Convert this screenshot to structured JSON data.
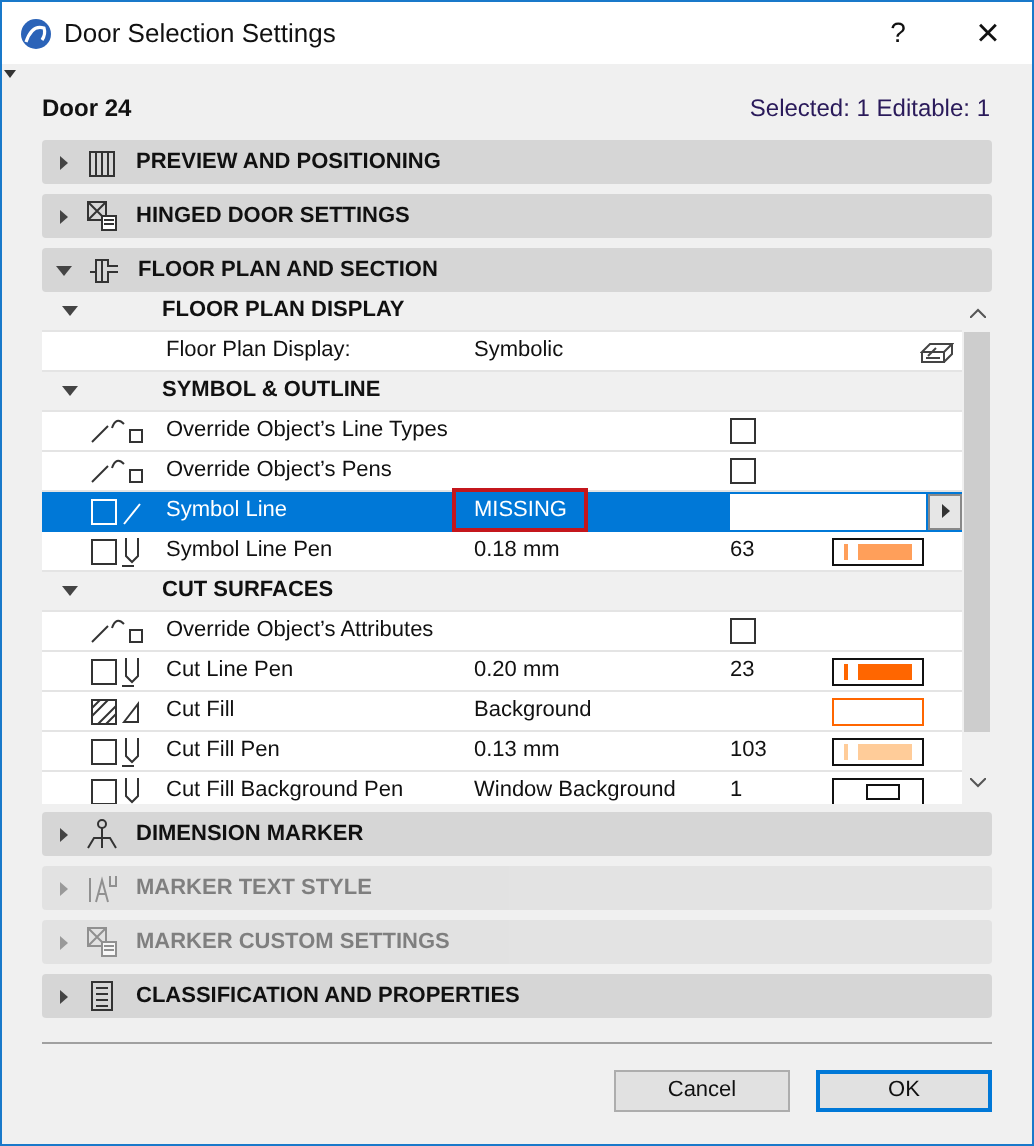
{
  "window": {
    "title": "Door Selection Settings",
    "help": "?",
    "close": "×"
  },
  "header": {
    "element": "Door 24",
    "selection": "Selected: 1 Editable: 1"
  },
  "panels_top": [
    {
      "title": "PREVIEW AND POSITIONING",
      "expanded": false,
      "disabled": false
    },
    {
      "title": "HINGED DOOR SETTINGS",
      "expanded": false,
      "disabled": false
    },
    {
      "title": "FLOOR PLAN AND SECTION",
      "expanded": true,
      "disabled": false
    }
  ],
  "table": {
    "groups": [
      {
        "title": "FLOOR PLAN DISPLAY",
        "expanded": true,
        "rows": [
          {
            "kind": "display",
            "label": "Floor Plan Display:",
            "value": "Symbolic",
            "selected": false
          }
        ]
      },
      {
        "title": "SYMBOL & OUTLINE",
        "expanded": true,
        "rows": [
          {
            "kind": "checkbox",
            "label": "Override Object’s Line Types",
            "checked": false,
            "selected": false
          },
          {
            "kind": "checkbox",
            "label": "Override Object’s Pens",
            "checked": false,
            "selected": false
          },
          {
            "kind": "line",
            "label": "Symbol Line",
            "value": "MISSING",
            "error": true,
            "selected": true
          },
          {
            "kind": "pen",
            "label": "Symbol Line Pen",
            "value": "0.18 mm",
            "number": "63",
            "color": "#ff9f5a",
            "selected": false
          }
        ]
      },
      {
        "title": "CUT SURFACES",
        "expanded": true,
        "rows": [
          {
            "kind": "checkbox",
            "label": "Override Object’s Attributes",
            "checked": false,
            "selected": false
          },
          {
            "kind": "pen",
            "label": "Cut Line Pen",
            "value": "0.20 mm",
            "number": "23",
            "color": "#ff6600",
            "selected": false
          },
          {
            "kind": "fill",
            "label": "Cut Fill",
            "value": "Background",
            "color": "#ff6600",
            "selected": false
          },
          {
            "kind": "pen",
            "label": "Cut Fill Pen",
            "value": "0.13 mm",
            "number": "103",
            "color": "#ffcc99",
            "selected": false
          },
          {
            "kind": "pen",
            "label": "Cut Fill Background Pen",
            "value": "Window Background",
            "number": "1",
            "color": "#ffffff",
            "selected": false
          }
        ]
      }
    ]
  },
  "panels_bottom": [
    {
      "title": "DIMENSION MARKER",
      "expanded": false,
      "disabled": false
    },
    {
      "title": "MARKER TEXT STYLE",
      "expanded": false,
      "disabled": true
    },
    {
      "title": "MARKER CUSTOM SETTINGS",
      "expanded": false,
      "disabled": true
    },
    {
      "title": "CLASSIFICATION AND PROPERTIES",
      "expanded": false,
      "disabled": false
    }
  ],
  "buttons": [
    {
      "label": "Cancel",
      "default": false
    },
    {
      "label": "OK",
      "default": true
    }
  ]
}
